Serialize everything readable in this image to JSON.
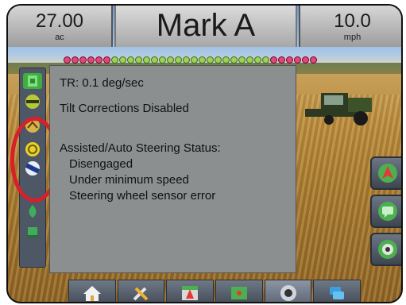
{
  "header": {
    "left": {
      "value": "27.00",
      "unit": "ac"
    },
    "title": "Mark A",
    "right": {
      "value": "10.0",
      "unit": "mph"
    }
  },
  "dialog": {
    "tilt_rate": "TR: 0.1 deg/sec",
    "tilt_status": "Tilt Corrections Disabled",
    "steering_heading": "Assisted/Auto Steering Status:",
    "steering_lines": [
      "Disengaged",
      "Under minimum speed",
      "Steering wheel sensor error"
    ]
  },
  "colors": {
    "section_on": "#e0477f",
    "section_alt": "#9ad25a",
    "highlight": "#d7202a"
  },
  "left_strip_icons": [
    "boom-icon",
    "guidance-bar-icon",
    "tilt-icon",
    "steering-warning-icon",
    "steering-wheel-icon",
    "vehicle-icon",
    "gps-icon"
  ],
  "right_buttons": [
    "screen-view-icon",
    "chat-icon",
    "camera-icon"
  ],
  "bottom_buttons": [
    "home-icon",
    "tools-icon",
    "field-icon",
    "map-icon",
    "video-icon",
    "data-icon"
  ]
}
